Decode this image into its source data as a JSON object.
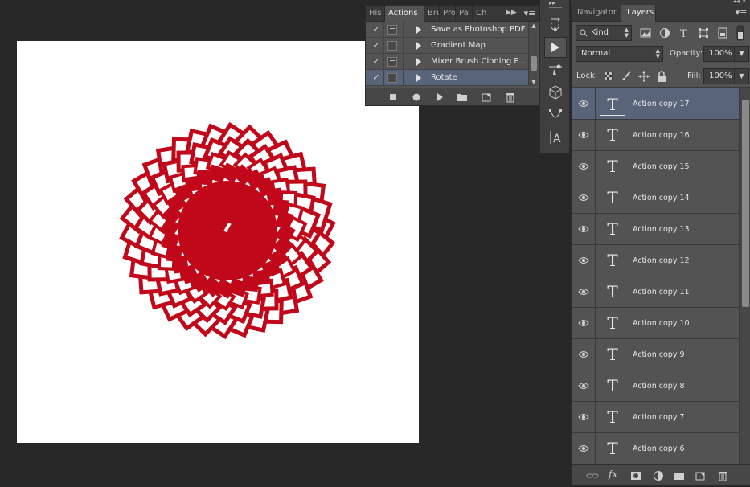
{
  "canvas": {
    "background": "#ffffff",
    "art_color": "#c0081a"
  },
  "actions_panel": {
    "tabs": [
      "History",
      "Actions",
      "Brushes",
      "Properties",
      "Paragraph",
      "Character"
    ],
    "tabs_visible": [
      "His",
      "Actions",
      "Bru",
      "Pro",
      "Pa",
      "Ch"
    ],
    "menu_icon": "panel-menu-icon",
    "rows": [
      {
        "checked": true,
        "dialog": true,
        "label": "Save as Photoshop PDF"
      },
      {
        "checked": true,
        "dialog": false,
        "label": "Gradient Map"
      },
      {
        "checked": true,
        "dialog": true,
        "label": "Mixer Brush Cloning P..."
      },
      {
        "checked": true,
        "dialog": false,
        "label": "Rotate",
        "selected": true
      }
    ],
    "footer_icons": [
      "stop-icon",
      "record-icon",
      "play-icon",
      "new-set-icon",
      "new-action-icon",
      "delete-icon"
    ]
  },
  "tool_strip": {
    "tools": [
      "history-brush-icon",
      "play-icon",
      "brush-preset-icon",
      "3d-icon",
      "path-icon",
      "character-icon"
    ]
  },
  "layers_panel": {
    "tabs": [
      "Navigator",
      "Layers"
    ],
    "active_tab": "Layers",
    "filter": {
      "label": "Kind"
    },
    "blend_mode": "Normal",
    "opacity_label": "Opacity:",
    "opacity": "100%",
    "lock_label": "Lock:",
    "fill_label": "Fill:",
    "fill": "100%",
    "layers": [
      {
        "name": "Action copy 17",
        "selected": true
      },
      {
        "name": "Action copy 16"
      },
      {
        "name": "Action copy 15"
      },
      {
        "name": "Action copy 14"
      },
      {
        "name": "Action copy 13"
      },
      {
        "name": "Action copy 12"
      },
      {
        "name": "Action copy 11"
      },
      {
        "name": "Action copy 10"
      },
      {
        "name": "Action copy 9"
      },
      {
        "name": "Action copy 8"
      },
      {
        "name": "Action copy 7"
      },
      {
        "name": "Action copy 6"
      }
    ],
    "layer_glyph": "T",
    "footer_icons": [
      "link-icon",
      "fx-icon",
      "mask-icon",
      "adjustment-icon",
      "group-icon",
      "new-layer-icon",
      "delete-icon"
    ],
    "fx_label": "fx"
  },
  "colors": {
    "panel_bg": "#535353",
    "selection": "#57647a",
    "app_bg": "#282828"
  }
}
